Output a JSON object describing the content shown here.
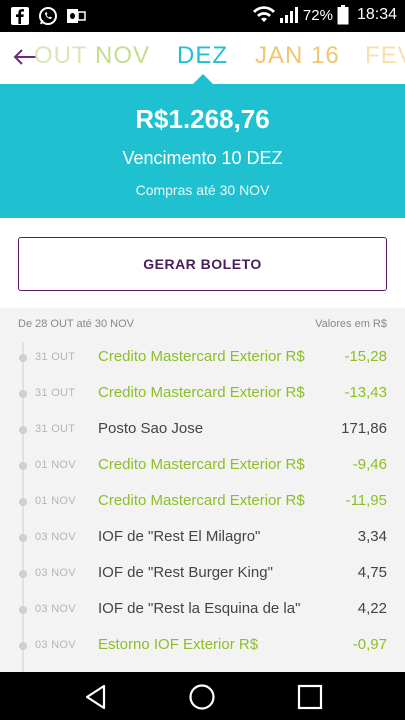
{
  "status_bar": {
    "battery": "72%",
    "time": "18:34",
    "icons": [
      "facebook-icon",
      "whatsapp-icon",
      "outlook-icon",
      "wifi-icon",
      "signal-icon",
      "battery-icon"
    ]
  },
  "months": {
    "items": [
      "OUT",
      "NOV",
      "DEZ",
      "JAN 16",
      "FEV"
    ],
    "selected": "DEZ",
    "colors": {
      "past": "#c6dc8f",
      "selected": "#1fc1d1",
      "future": "#f3c56e"
    }
  },
  "summary": {
    "amount": "R$1.268,76",
    "due_label": "Vencimento 10 DEZ",
    "purchases_until": "Compras até 30 NOV",
    "bg_color": "#1fc1d1"
  },
  "boleto": {
    "label": "GERAR BOLETO"
  },
  "list": {
    "range": "De 28 OUT até 30 NOV",
    "currency_note": "Valores em R$",
    "transactions": [
      {
        "date": "31 OUT",
        "description": "Credito Mastercard Exterior R$",
        "value": "-15,28",
        "credit": true
      },
      {
        "date": "31 OUT",
        "description": "Credito Mastercard Exterior R$",
        "value": "-13,43",
        "credit": true
      },
      {
        "date": "31 OUT",
        "description": "Posto Sao Jose",
        "value": "171,86",
        "credit": false
      },
      {
        "date": "01 NOV",
        "description": "Credito Mastercard Exterior R$",
        "value": "-9,46",
        "credit": true
      },
      {
        "date": "01 NOV",
        "description": "Credito Mastercard Exterior R$",
        "value": "-11,95",
        "credit": true
      },
      {
        "date": "03 NOV",
        "description": "IOF de \"Rest El Milagro\"",
        "value": "3,34",
        "credit": false
      },
      {
        "date": "03 NOV",
        "description": "IOF de \"Rest Burger King\"",
        "value": "4,75",
        "credit": false
      },
      {
        "date": "03 NOV",
        "description": "IOF de \"Rest la Esquina de la\"",
        "value": "4,22",
        "credit": false
      },
      {
        "date": "03 NOV",
        "description": "Estorno IOF Exterior R$",
        "value": "-0,97",
        "credit": true
      }
    ],
    "colors": {
      "credit": "#8cbf26",
      "debit": "#444444"
    }
  },
  "nav": {
    "icons": [
      "back-triangle-icon",
      "home-circle-icon",
      "recents-square-icon"
    ]
  }
}
